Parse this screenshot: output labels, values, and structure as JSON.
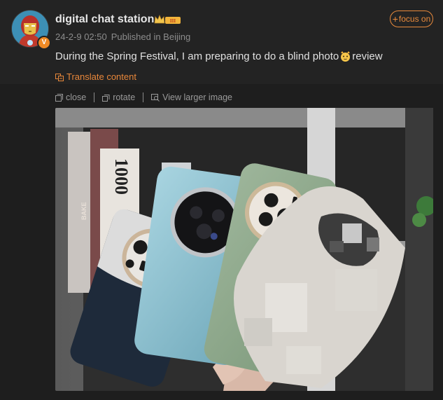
{
  "post": {
    "username": "digital chat station",
    "vip_badge_text": "III",
    "verified_mark": "V",
    "date": "24-2-9 02:50",
    "location": "Published in Beijing",
    "text_before_emoji": "During the Spring Festival, I am preparing to do a blind photo",
    "text_after_emoji": "review",
    "emoji": "cat-face-emoji",
    "translate_label": "Translate content",
    "follow_label": "focus on"
  },
  "toolbar": {
    "close_label": "close",
    "rotate_label": "rotate",
    "view_larger_label": "View larger image"
  },
  "photo": {
    "book_spine_text": "1000",
    "book_side_text": "BAKE",
    "subject": "four phones held in hand, one pixelated"
  },
  "colors": {
    "accent": "#e8873a",
    "background": "#232323",
    "text": "#e0e0e0",
    "muted": "#8c8c8c"
  },
  "icons": [
    "avatar-ironman",
    "crown-icon",
    "translate-icon",
    "close-icon",
    "rotate-icon",
    "view-larger-icon",
    "plus-icon"
  ]
}
